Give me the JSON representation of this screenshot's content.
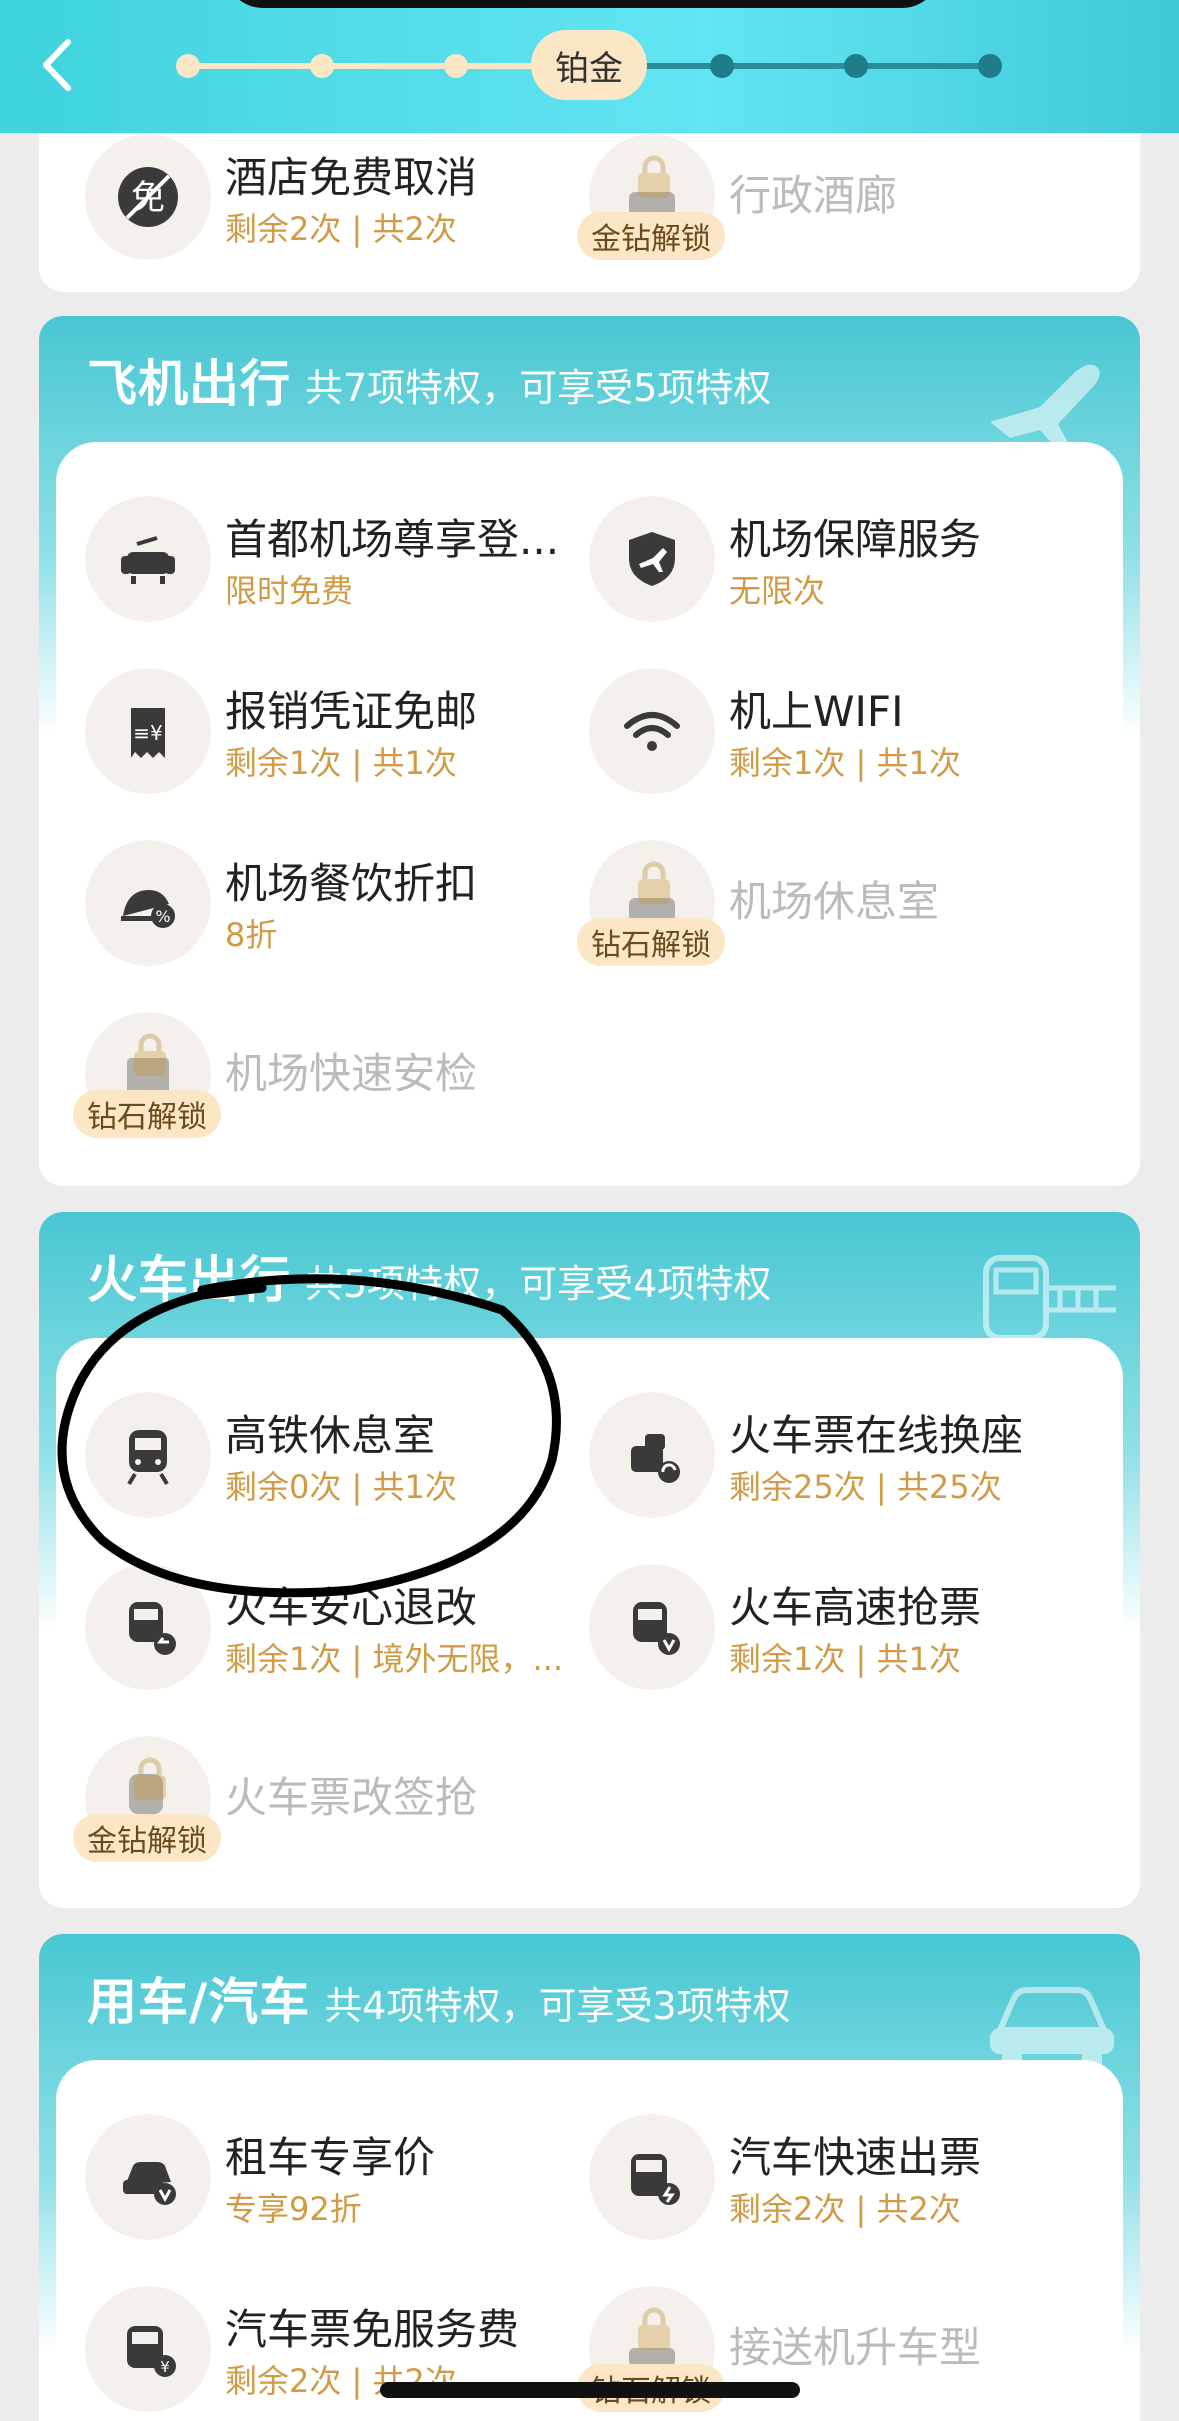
{
  "header": {
    "back_icon": "chevron-left-icon",
    "current_level": "铂金",
    "progress_done_dots": 3,
    "progress_todo_dots": 3
  },
  "hotel_partial": {
    "items": [
      {
        "name": "酒店免费取消",
        "sub": "剩余2次 | 共2次",
        "icon": "free-cancel-icon",
        "locked": false
      },
      {
        "name": "行政酒廊",
        "badge": "金钻解锁",
        "icon": "lounge-icon",
        "locked": true
      }
    ]
  },
  "flight": {
    "title": "飞机出行",
    "summary": "共7项特权，可享受5项特权",
    "items": [
      {
        "name": "首都机场尊享登...",
        "sub": "限时免费",
        "icon": "vip-seat-icon",
        "locked": false
      },
      {
        "name": "机场保障服务",
        "sub": "无限次",
        "icon": "shield-plane-icon",
        "locked": false
      },
      {
        "name": "报销凭证免邮",
        "sub": "剩余1次 | 共1次",
        "icon": "receipt-icon",
        "locked": false
      },
      {
        "name": "机上WIFI",
        "sub": "剩余1次 | 共1次",
        "icon": "wifi-icon",
        "locked": false
      },
      {
        "name": "机场餐饮折扣",
        "sub": "8折",
        "icon": "dining-discount-icon",
        "locked": false
      },
      {
        "name": "机场休息室",
        "badge": "钻石解锁",
        "icon": "lounge-icon",
        "locked": true
      },
      {
        "name": "机场快速安检",
        "badge": "钻石解锁",
        "icon": "security-check-icon",
        "locked": true
      }
    ]
  },
  "train": {
    "title": "火车出行",
    "summary": "共5项特权，可享受4项特权",
    "items": [
      {
        "name": "高铁休息室",
        "sub": "剩余0次 | 共1次",
        "icon": "train-icon",
        "locked": false
      },
      {
        "name": "火车票在线换座",
        "sub": "剩余25次 | 共25次",
        "icon": "seat-swap-icon",
        "locked": false
      },
      {
        "name": "火车安心退改",
        "sub": "剩余1次 | 境外无限，...",
        "icon": "train-refund-icon",
        "locked": false
      },
      {
        "name": "火车高速抢票",
        "sub": "剩余1次 | 共1次",
        "icon": "train-fast-ticket-icon",
        "locked": false
      },
      {
        "name": "火车票改签抢",
        "badge": "金钻解锁",
        "icon": "train-change-icon",
        "locked": true
      }
    ]
  },
  "car": {
    "title": "用车/汽车",
    "summary": "共4项特权，可享受3项特权",
    "items": [
      {
        "name": "租车专享价",
        "sub": "专享92折",
        "icon": "car-rental-icon",
        "locked": false
      },
      {
        "name": "汽车快速出票",
        "sub": "剩余2次 | 共2次",
        "icon": "bus-fast-icon",
        "locked": false
      },
      {
        "name": "汽车票免服务费",
        "sub": "剩余2次 | 共2次",
        "icon": "bus-fee-icon",
        "locked": false
      },
      {
        "name": "接送机升车型",
        "badge": "钻石解锁",
        "icon": "car-upgrade-icon",
        "locked": true
      }
    ]
  },
  "colors": {
    "teal": "#47c7d2",
    "gold_text": "#d19a45",
    "badge_bg": "#fbe7c6",
    "icon_dark": "#3a3a3a"
  }
}
